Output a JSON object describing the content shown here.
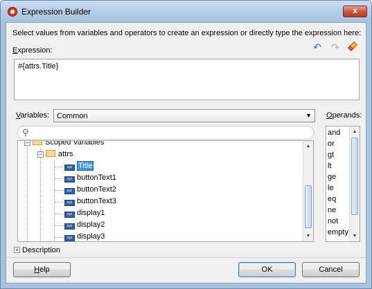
{
  "window": {
    "title": "Expression Builder",
    "close_label": "x"
  },
  "instructions": "Select values from variables and operators to create an expression or directly type the expression here:",
  "expression": {
    "label_mnemonic": "E",
    "label_rest": "xpression:",
    "value": "#{attrs.Title}"
  },
  "toolbar": {
    "undo_icon": "undo-icon",
    "redo_icon": "redo-icon",
    "clear_icon": "eraser-icon"
  },
  "variables": {
    "label_mnemonic": "V",
    "label_rest": "ariables:",
    "selected": "Common"
  },
  "search": {
    "icon": "search-icon",
    "value": ""
  },
  "tree": {
    "scoped_variables": "Scoped Variables",
    "attrs": "attrs",
    "items": [
      "Title",
      "buttonText1",
      "buttonText2",
      "buttonText3",
      "display1",
      "display2",
      "display3"
    ],
    "selected_item": "Title"
  },
  "operands": {
    "label_mnemonic": "O",
    "label_rest": "perands:",
    "items": [
      "and",
      "or",
      "gt",
      "lt",
      "ge",
      "le",
      "eq",
      "ne",
      "not",
      "empty"
    ]
  },
  "description": {
    "label": "Description"
  },
  "buttons": {
    "help_mnemonic": "H",
    "help_rest": "elp",
    "ok": "OK",
    "cancel": "Cancel"
  }
}
